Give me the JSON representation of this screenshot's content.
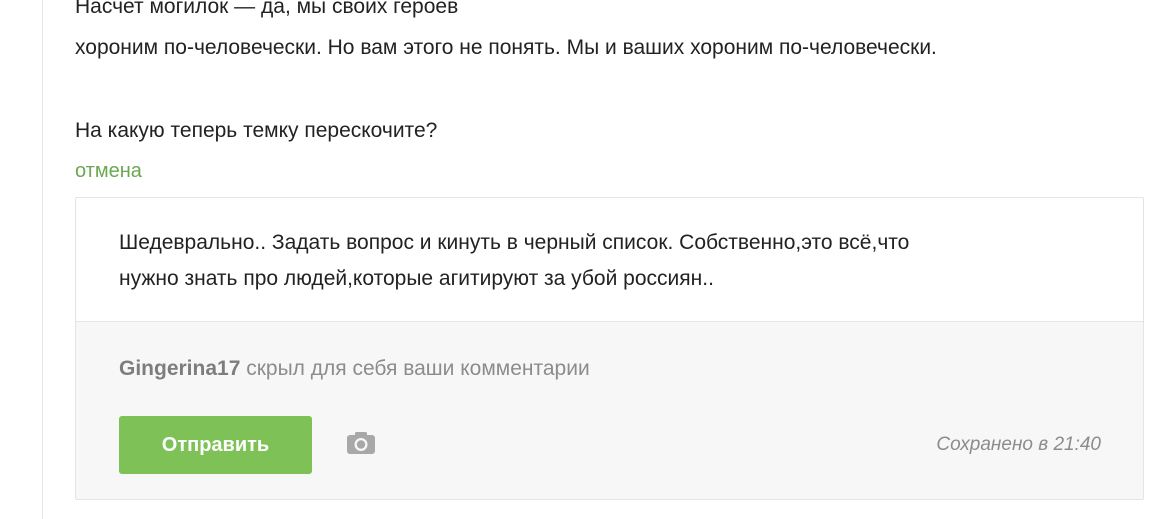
{
  "quoted_comment": {
    "lines": [
      "Насчет могилок — да, мы своих героев",
      "хороним по-человечески. Но вам этого не понять. Мы и ваших хороним по-человечески.",
      "На какую теперь темку перескочите?"
    ]
  },
  "cancel_label": "отмена",
  "reply": {
    "text_lines": [
      "Шедеврально.. Задать вопрос и кинуть в черный список. Собственно,это всё,что",
      "нужно знать про людей,которые агитируют за убой россиян.."
    ]
  },
  "notice": {
    "username": "Gingerina17",
    "message": " скрыл для себя ваши комментарии"
  },
  "actions": {
    "submit_label": "Отправить",
    "photo_icon": "camera-icon",
    "saved_status": "Сохранено в 21:40"
  },
  "colors": {
    "accent_green": "#7ec257",
    "link_green": "#6aa84f",
    "muted_text": "#8c8c8c",
    "footer_bg": "#f7f7f8"
  }
}
